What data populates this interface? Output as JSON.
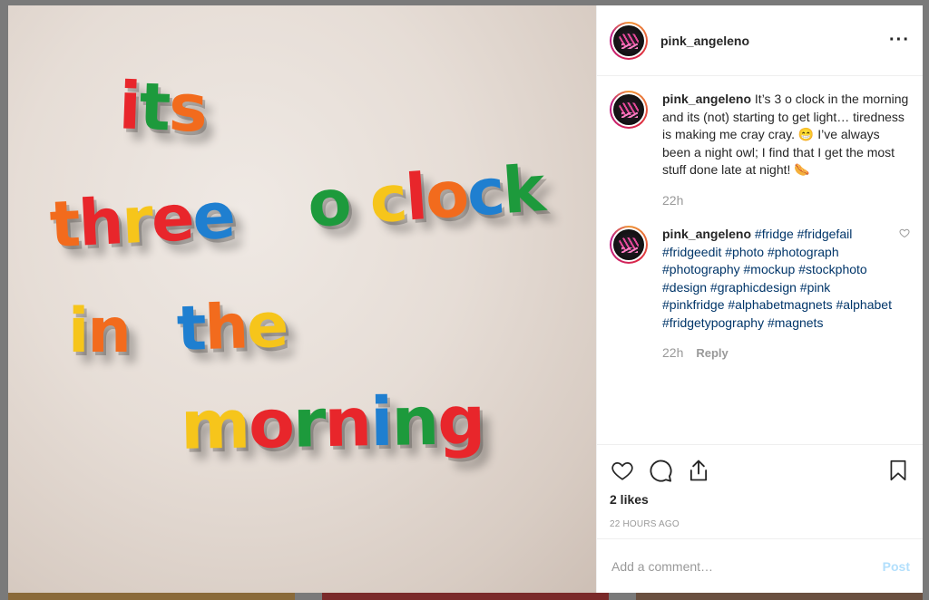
{
  "photo": {
    "lines": [
      {
        "id": "line1",
        "letters": [
          {
            "ch": "i",
            "color": "#e8262b"
          },
          {
            "ch": "t",
            "color": "#1d9a3c"
          },
          {
            "ch": "s",
            "color": "#f26b1d"
          }
        ]
      },
      {
        "id": "line2a",
        "letters": [
          {
            "ch": "t",
            "color": "#f26b1d"
          },
          {
            "ch": "h",
            "color": "#e8262b"
          },
          {
            "ch": "r",
            "color": "#f6c51b"
          },
          {
            "ch": "e",
            "color": "#e8262b"
          },
          {
            "ch": "e",
            "color": "#1f7fd0"
          }
        ]
      },
      {
        "id": "line2b",
        "letters": [
          {
            "ch": "o",
            "color": "#1d9a3c"
          },
          {
            "ch": " ",
            "color": "#000000"
          },
          {
            "ch": "c",
            "color": "#f6c51b"
          },
          {
            "ch": "l",
            "color": "#e8262b"
          },
          {
            "ch": "o",
            "color": "#f26b1d"
          },
          {
            "ch": "c",
            "color": "#1f7fd0"
          },
          {
            "ch": "k",
            "color": "#1d9a3c"
          }
        ]
      },
      {
        "id": "line3a",
        "letters": [
          {
            "ch": "i",
            "color": "#f6c51b"
          },
          {
            "ch": "n",
            "color": "#f26b1d"
          }
        ]
      },
      {
        "id": "line3b",
        "letters": [
          {
            "ch": "t",
            "color": "#1f7fd0"
          },
          {
            "ch": "h",
            "color": "#f26b1d"
          },
          {
            "ch": "e",
            "color": "#f6c51b"
          }
        ]
      },
      {
        "id": "line4",
        "letters": [
          {
            "ch": "m",
            "color": "#f6c51b"
          },
          {
            "ch": "o",
            "color": "#e8262b"
          },
          {
            "ch": "r",
            "color": "#1d9a3c"
          },
          {
            "ch": "n",
            "color": "#e8262b"
          },
          {
            "ch": "i",
            "color": "#1f7fd0"
          },
          {
            "ch": "n",
            "color": "#1d9a3c"
          },
          {
            "ch": "g",
            "color": "#e8262b"
          }
        ]
      }
    ]
  },
  "header": {
    "username": "pink_angeleno",
    "more_icon": "more-horizontal-icon",
    "more_glyph": "···"
  },
  "comments": [
    {
      "author": "pink_angeleno",
      "text": "It’s 3 o clock in the morning and its (not) starting to get light… tiredness is making me cray cray. 😁 I’ve always been a night owl; I find that I get the most stuff done late at night! 🌭",
      "tags": "",
      "time": "22h",
      "reply": ""
    },
    {
      "author": "pink_angeleno",
      "text": "",
      "tags": "#fridge #fridgefail #fridgeedit #photo #photograph #photography #mockup #stockphoto #design #graphicdesign #pink #pinkfridge #alphabetmagnets #alphabet #fridgetypography #magnets",
      "time": "22h",
      "reply": "Reply"
    }
  ],
  "actions": {
    "icons": [
      "heart-icon",
      "comment-icon",
      "share-icon",
      "bookmark-icon"
    ],
    "likes": "2 likes",
    "time_ago": "22 HOURS AGO"
  },
  "add_comment": {
    "placeholder": "Add a comment…",
    "post_label": "Post"
  },
  "colors": {
    "link": "#003569",
    "post_disabled": "#b2dffc",
    "muted": "#999999"
  }
}
